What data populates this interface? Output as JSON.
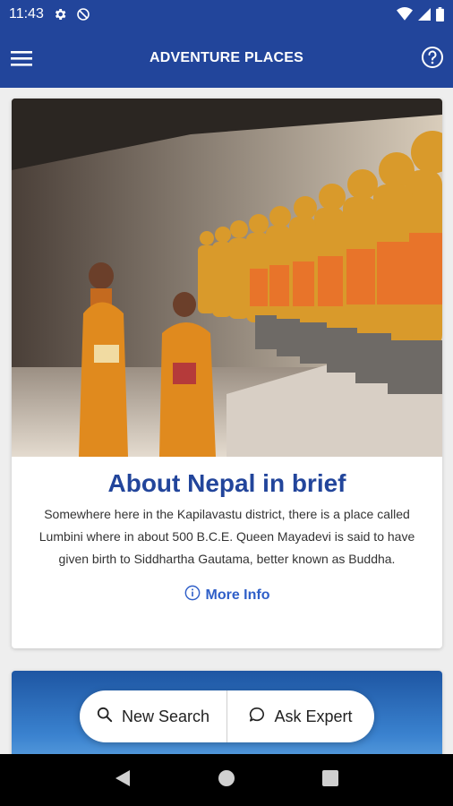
{
  "status_bar": {
    "time": "11:43"
  },
  "app_bar": {
    "title": "ADVENTURE PLACES"
  },
  "card": {
    "title": "About Nepal in brief",
    "description": "Somewhere here in the Kapilavastu district, there is a place called Lumbini where in about 500 B.C.E. Queen Mayadevi is said to have given birth to Siddhartha Gautama, better known as Buddha.",
    "more_info_label": "More Info"
  },
  "actions": {
    "new_search_label": "New Search",
    "ask_expert_label": "Ask Expert"
  },
  "icons": [
    "settings-icon",
    "no-sync-icon",
    "wifi-icon",
    "signal-icon",
    "battery-icon",
    "menu-icon",
    "help-icon",
    "info-icon",
    "search-icon",
    "chat-icon",
    "back-icon",
    "home-icon",
    "recents-icon"
  ],
  "colors": {
    "primary": "#22459b",
    "link": "#2f5fc8"
  }
}
